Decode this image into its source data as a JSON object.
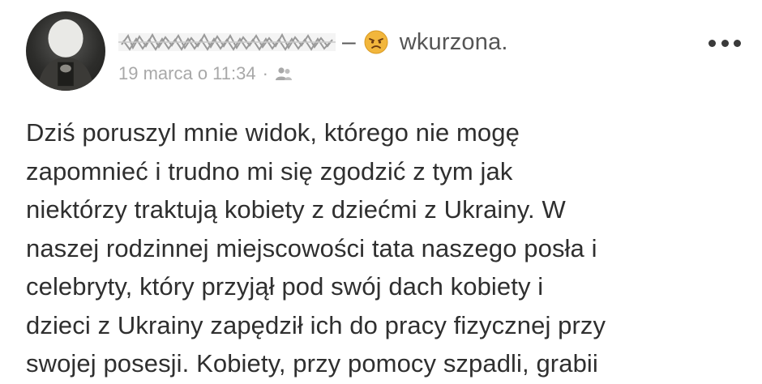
{
  "post": {
    "author_name": "████████ █████",
    "dash": "–",
    "feeling_icon": "angry-face-emoji",
    "feeling": "wkurzona.",
    "timestamp": "19 marca o 11:34",
    "meta_separator": "·",
    "audience_icon": "friends-icon",
    "more_icon": "more-options-icon",
    "text_lines": [
      "Dziś poruszyl mnie widok, którego nie mogę",
      "zapomnieć i trudno mi się zgodzić z tym jak",
      "niektórzy traktują kobiety z dziećmi z Ukrainy. W",
      "naszej rodzinnej miejscowości tata naszego posła i",
      "celebryty, który przyjął pod swój dach kobiety i",
      "dzieci z Ukrainy zapędził ich do pracy fizycznej przy",
      "swojej posesji. Kobiety, przy pomocy szpadli, grabii"
    ]
  },
  "colors": {
    "text": "#2f2f2f",
    "meta": "#a8a8a8",
    "emoji": "#f2b63c"
  }
}
